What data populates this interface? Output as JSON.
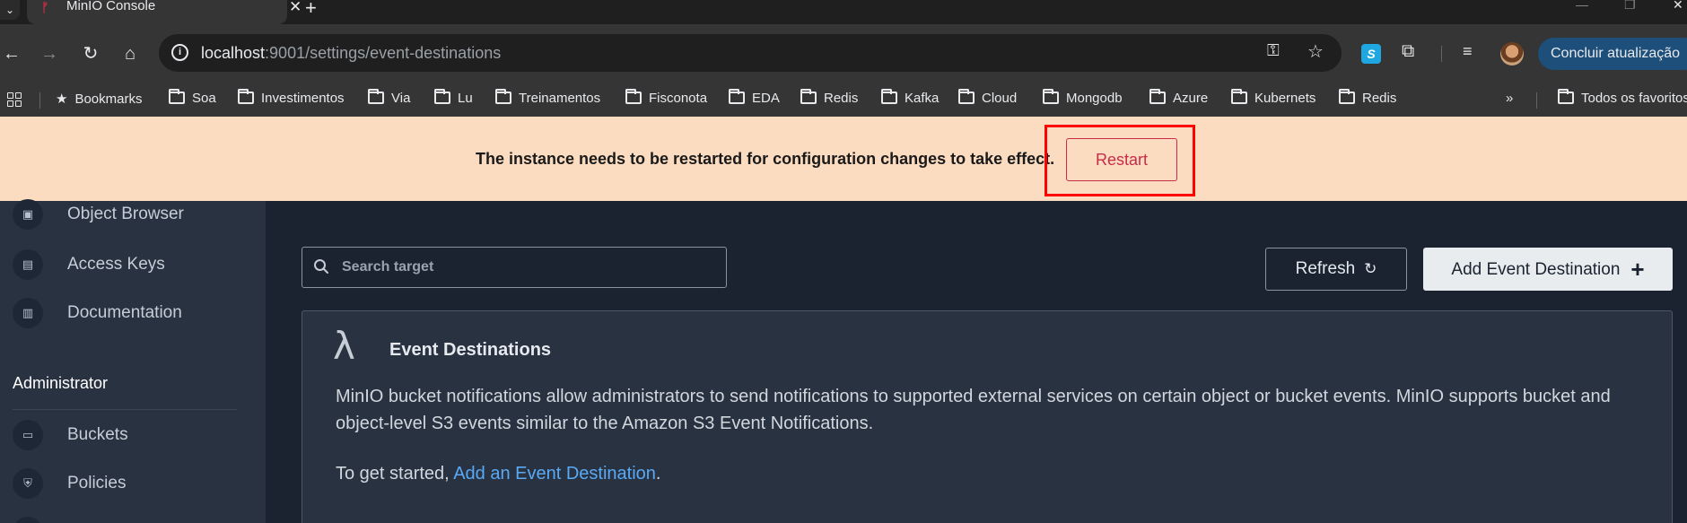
{
  "browser": {
    "tab_title": "MinIO Console",
    "url_host": "localhost",
    "url_path": ":9001/settings/event-destinations",
    "update_label": "Concluir atualização"
  },
  "bookmarks": {
    "items": [
      {
        "label": "Bookmarks",
        "icon": "star-icon"
      },
      {
        "label": "Soa",
        "icon": "folder-icon"
      },
      {
        "label": "Investimentos",
        "icon": "folder-icon"
      },
      {
        "label": "Via",
        "icon": "folder-icon"
      },
      {
        "label": "Lu",
        "icon": "folder-icon"
      },
      {
        "label": "Treinamentos",
        "icon": "folder-icon"
      },
      {
        "label": "Fisconota",
        "icon": "folder-icon"
      },
      {
        "label": "EDA",
        "icon": "folder-icon"
      },
      {
        "label": "Redis",
        "icon": "folder-icon"
      },
      {
        "label": "Kafka",
        "icon": "folder-icon"
      },
      {
        "label": "Cloud",
        "icon": "folder-icon"
      },
      {
        "label": "Mongodb",
        "icon": "folder-icon"
      },
      {
        "label": "Azure",
        "icon": "folder-icon"
      },
      {
        "label": "Kubernets",
        "icon": "folder-icon"
      },
      {
        "label": "Redis",
        "icon": "folder-icon"
      }
    ],
    "more": "»",
    "other_label": "Todos os favoritos"
  },
  "banner": {
    "message": "The instance needs to be restarted for configuration changes to take effect.",
    "restart_label": "Restart"
  },
  "sidebar": {
    "items_top": [
      {
        "label": "Object Browser",
        "icon": "object-browser-icon"
      },
      {
        "label": "Access Keys",
        "icon": "access-keys-icon"
      },
      {
        "label": "Documentation",
        "icon": "documentation-icon"
      }
    ],
    "admin_heading": "Administrator",
    "items_admin": [
      {
        "label": "Buckets",
        "icon": "buckets-icon"
      },
      {
        "label": "Policies",
        "icon": "policies-icon"
      }
    ]
  },
  "main": {
    "search_placeholder": "Search target",
    "refresh_label": "Refresh",
    "add_label": "Add Event Destination",
    "card": {
      "title": "Event Destinations",
      "description": "MinIO bucket notifications allow administrators to send notifications to supported external services on certain object or bucket events. MinIO supports bucket and object-level S3 events similar to the Amazon S3 Event Notifications.",
      "start_prefix": "To get started, ",
      "start_link": "Add an Event Destination",
      "start_suffix": "."
    }
  },
  "colors": {
    "banner_bg": "#fbdcc0",
    "accent_red": "#c72c48",
    "sidebar_bg": "#283241",
    "main_bg": "#1b2331",
    "link": "#5aa9f5"
  }
}
